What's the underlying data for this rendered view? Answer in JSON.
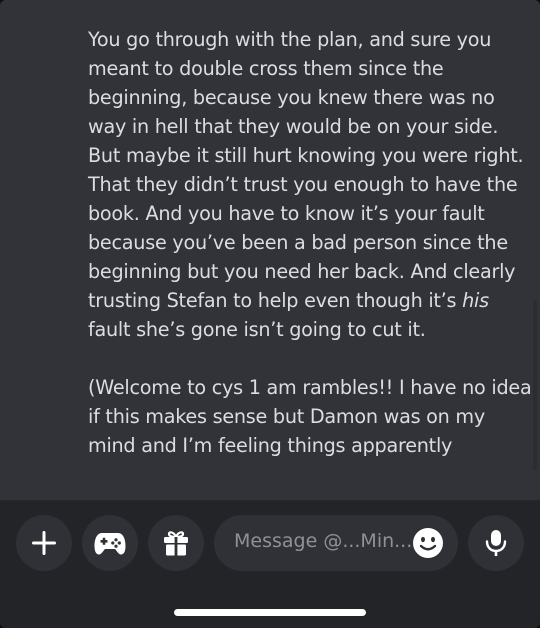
{
  "message": {
    "lines": [
      "You go through with the plan, and sure you",
      "meant to double cross them since the",
      "beginning, because you knew there was no",
      "way in hell that they would be on your side.",
      "But maybe it still hurt knowing you were right.",
      "That they didn’t trust you enough to have the",
      "book. And you have to know it’s your fault",
      "because you’ve been a bad person since the",
      "beginning but you need her back. And clearly"
    ],
    "line10_before": "trusting Stefan to help even though it’s ",
    "line10_italic": "his",
    "line11": "fault she’s gone isn’t going to cut it.",
    "lines2": [
      "(Welcome to cys 1 am rambles!! I have no idea",
      "if this makes sense but Damon was on my",
      "mind and I’m feeling things apparently"
    ]
  },
  "composer": {
    "placeholder": "Message @...Min...",
    "icons": {
      "add": "plus-icon",
      "game": "gamepad-icon",
      "gift": "gift-icon",
      "emoji": "emoji-icon",
      "mic": "microphone-icon"
    }
  },
  "colors": {
    "background": "#313338",
    "composer_background": "#232428",
    "button_background": "#2f3136",
    "text": "#dbdee1",
    "placeholder": "#8e9297",
    "icon": "#ffffff"
  }
}
